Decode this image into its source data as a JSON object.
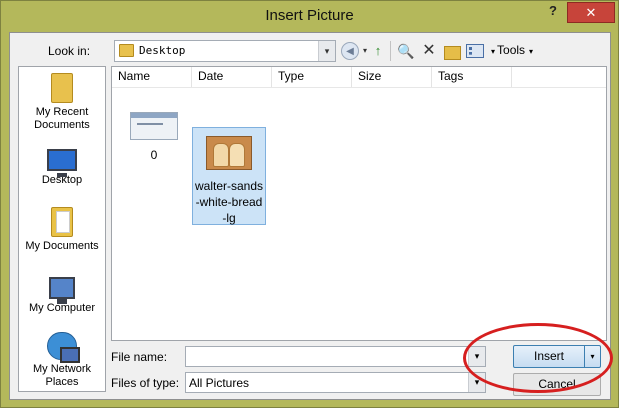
{
  "dialog": {
    "title": "Insert Picture",
    "help_glyph": "?",
    "close_glyph": "✕"
  },
  "toolbar": {
    "look_in_label": "Look in:",
    "look_in_value": "Desktop",
    "dropdown_glyph": "▾",
    "back_glyph": "◀",
    "up_glyph": "↑",
    "search_glyph": "🔍",
    "delete_glyph": "✕",
    "tools_label": "Tools"
  },
  "places": [
    {
      "label": "My Recent Documents",
      "icon": "recent-documents-icon"
    },
    {
      "label": "Desktop",
      "icon": "desktop-icon"
    },
    {
      "label": "My Documents",
      "icon": "my-documents-icon"
    },
    {
      "label": "My Computer",
      "icon": "my-computer-icon"
    },
    {
      "label": "My Network Places",
      "icon": "network-places-icon"
    }
  ],
  "columns": [
    "Name",
    "Date",
    "Type",
    "Size",
    "Tags"
  ],
  "files": [
    {
      "name": "0",
      "selected": false
    },
    {
      "name": "walter-sands-white-bread-lg",
      "name_lines": [
        "walter-sands",
        "-white-bread",
        "-lg"
      ],
      "selected": true
    }
  ],
  "form": {
    "file_name_label": "File name:",
    "file_name_value": "",
    "files_of_type_label": "Files of type:",
    "files_of_type_value": "All Pictures"
  },
  "buttons": {
    "insert_label": "Insert",
    "cancel_label": "Cancel"
  },
  "colors": {
    "title_bar": "#b4b85b",
    "close_button": "#c7443a",
    "selection": "#cce3f7",
    "annotation": "#d61f1f"
  }
}
